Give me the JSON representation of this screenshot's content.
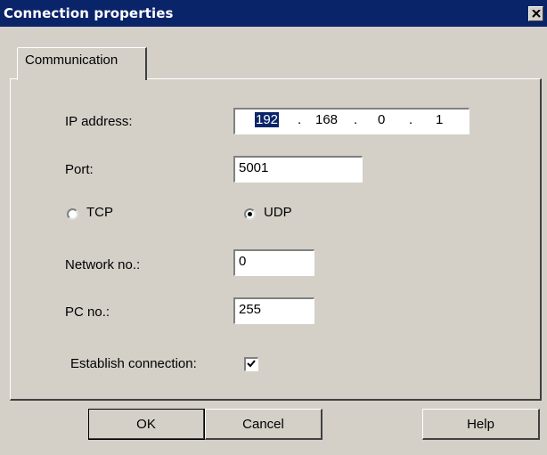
{
  "window": {
    "title": "Connection properties"
  },
  "tabs": [
    {
      "label": "Communication"
    }
  ],
  "form": {
    "ip_label": "IP address:",
    "ip_octets": [
      "192",
      "168",
      "0",
      "1"
    ],
    "ip_separator": ".",
    "port_label": "Port:",
    "port_value": "5001",
    "protocol": {
      "tcp_label": "TCP",
      "udp_label": "UDP",
      "selected": "UDP"
    },
    "network_label": "Network no.:",
    "network_value": "0",
    "pc_label": "PC no.:",
    "pc_value": "255",
    "establish_label": "Establish connection:",
    "establish_checked": true
  },
  "buttons": {
    "ok": "OK",
    "cancel": "Cancel",
    "help": "Help"
  },
  "colors": {
    "titlebar": "#0a246a",
    "face": "#d4d0c8",
    "selection": "#0a246a"
  },
  "icons": {
    "close": "close-icon",
    "check": "checkmark-icon"
  }
}
